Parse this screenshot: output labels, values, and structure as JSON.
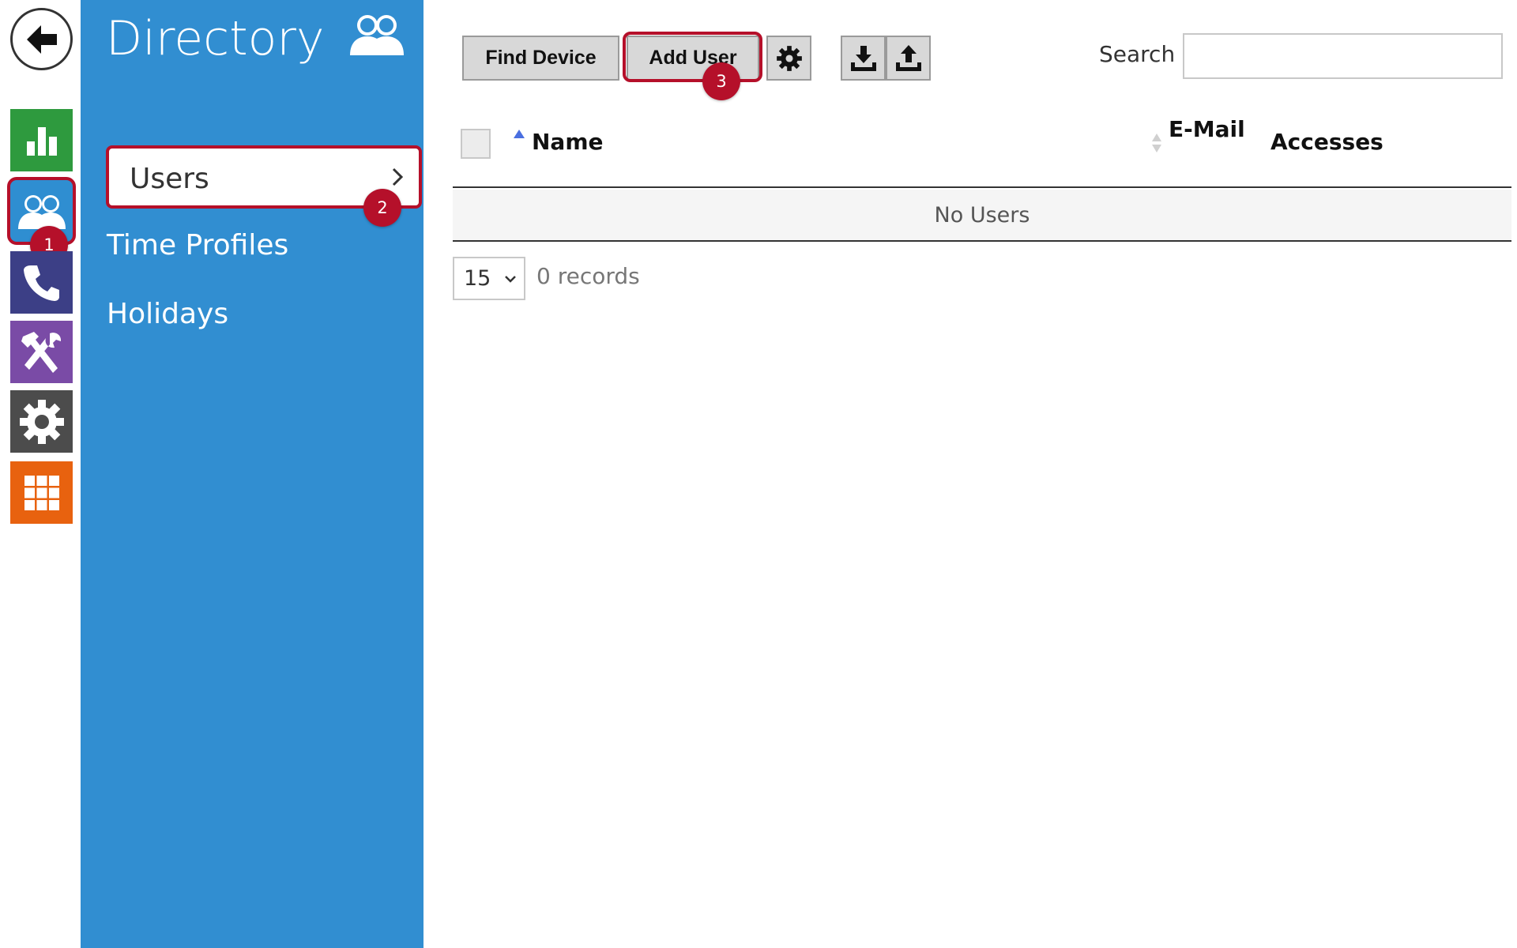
{
  "panel": {
    "title": "Directory",
    "menu": [
      {
        "label": "Users",
        "active": true
      },
      {
        "label": "Time Profiles"
      },
      {
        "label": "Holidays"
      }
    ]
  },
  "rail": {
    "icons": [
      "back-arrow-icon",
      "statistics-icon",
      "directory-icon",
      "calling-icon",
      "hardware-icon",
      "settings-icon",
      "apps-icon"
    ],
    "colors": {
      "green": "#2e9a3e",
      "blue": "#2f8ed1",
      "navy": "#3c3f86",
      "purple": "#7a4ba6",
      "dark": "#4c4c4c",
      "orange": "#e8620f"
    }
  },
  "toolbar": {
    "find_device": "Find Device",
    "add_user": "Add User"
  },
  "search": {
    "label": "Search",
    "value": ""
  },
  "table": {
    "columns": [
      "Name",
      "E-Mail",
      "Accesses"
    ],
    "empty_text": "No Users"
  },
  "pagination": {
    "page_size": "15",
    "records": "0 records"
  },
  "callouts": [
    "1",
    "2",
    "3"
  ],
  "accent": "#b5102a"
}
